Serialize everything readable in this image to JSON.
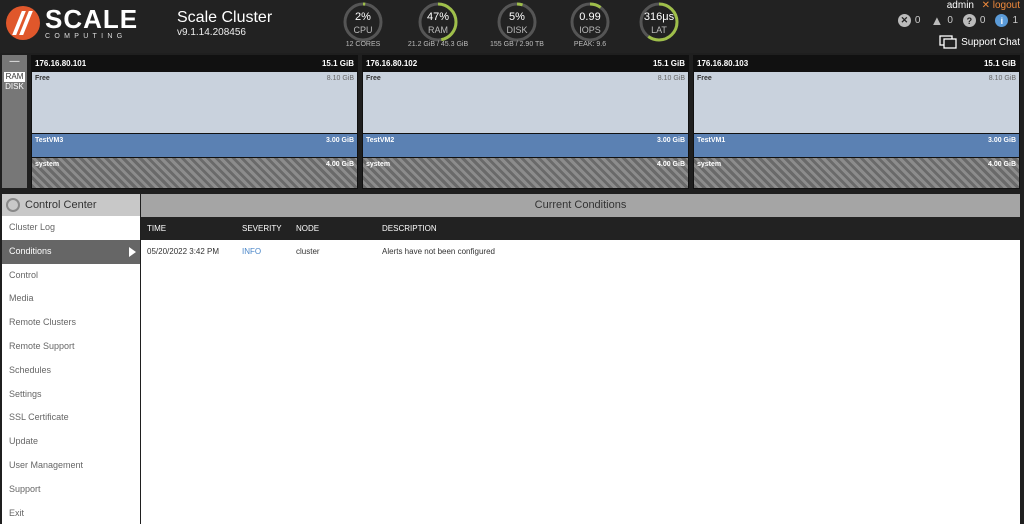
{
  "brand": {
    "word": "SCALE",
    "sub": "COMPUTING"
  },
  "cluster": {
    "title": "Scale Cluster",
    "version": "v9.1.14.208456"
  },
  "gauges": [
    {
      "value": "2%",
      "label": "CPU",
      "sub": "12 CORES",
      "level": 0.02,
      "color": "#9fbf4a"
    },
    {
      "value": "47%",
      "label": "RAM",
      "sub": "21.2 GiB / 45.3 GiB",
      "level": 0.47,
      "color": "#9fbf4a"
    },
    {
      "value": "5%",
      "label": "DISK",
      "sub": "155 GB / 2.90 TB",
      "level": 0.05,
      "color": "#9fbf4a"
    },
    {
      "value": "0.99",
      "label": "IOPS",
      "sub": "PEAK: 9.6",
      "level": 0.1,
      "color": "#9fbf4a"
    },
    {
      "value": "316μs",
      "label": "LAT",
      "sub": "",
      "level": 0.6,
      "color": "#9fbf4a"
    }
  ],
  "user": {
    "name": "admin",
    "logout": "logout"
  },
  "alerts": {
    "critical": "0",
    "warning": "0",
    "unknown": "0",
    "info": "1"
  },
  "support_chat": "Support Chat",
  "mem_toggle": {
    "collapse": "—",
    "ram": "RAM",
    "disk": "DISK"
  },
  "nodes": [
    {
      "ip": "176.16.80.101",
      "total": "15.1 GiB",
      "free_label": "Free",
      "free_size": "8.10 GiB",
      "vm_name": "TestVM3",
      "vm_size": "3.00 GiB",
      "sys_label": "system",
      "sys_size": "4.00 GiB"
    },
    {
      "ip": "176.16.80.102",
      "total": "15.1 GiB",
      "free_label": "Free",
      "free_size": "8.10 GiB",
      "vm_name": "TestVM2",
      "vm_size": "3.00 GiB",
      "sys_label": "system",
      "sys_size": "4.00 GiB"
    },
    {
      "ip": "176.16.80.103",
      "total": "15.1 GiB",
      "free_label": "Free",
      "free_size": "8.10 GiB",
      "vm_name": "TestVM1",
      "vm_size": "3.00 GiB",
      "sys_label": "system",
      "sys_size": "4.00 GiB"
    }
  ],
  "sidebar": {
    "title": "Control Center",
    "items": [
      {
        "label": "Cluster Log"
      },
      {
        "label": "Conditions"
      },
      {
        "label": "Control"
      },
      {
        "label": "Media"
      },
      {
        "label": "Remote Clusters"
      },
      {
        "label": "Remote Support"
      },
      {
        "label": "Schedules"
      },
      {
        "label": "Settings"
      },
      {
        "label": "SSL Certificate"
      },
      {
        "label": "Update"
      },
      {
        "label": "User Management"
      },
      {
        "label": "Support"
      },
      {
        "label": "Exit"
      }
    ]
  },
  "main": {
    "title": "Current Conditions",
    "columns": [
      "TIME",
      "SEVERITY",
      "NODE",
      "DESCRIPTION"
    ],
    "rows": [
      {
        "time": "05/20/2022 3:42 PM",
        "severity": "INFO",
        "node": "cluster",
        "description": "Alerts have not been configured"
      }
    ]
  }
}
